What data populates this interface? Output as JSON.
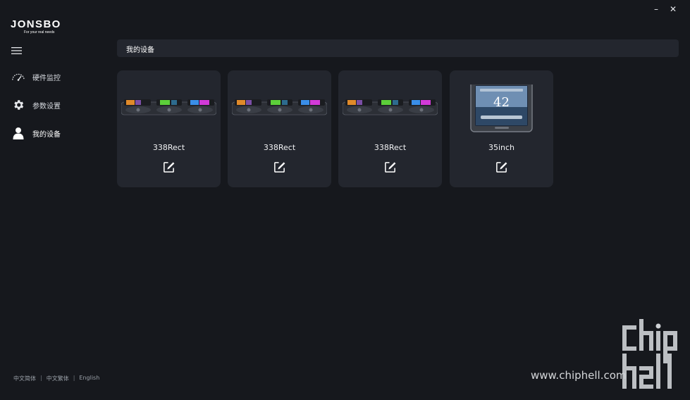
{
  "brand": {
    "name": "JONSBO",
    "tagline": "For your real needs"
  },
  "window": {
    "minimize_label": "–",
    "close_label": "✕"
  },
  "sidebar": {
    "menu_icon": "hamburger-icon",
    "items": [
      {
        "label": "硬件监控",
        "icon": "speedometer-icon",
        "active": false
      },
      {
        "label": "参数设置",
        "icon": "gear-icon",
        "active": false
      },
      {
        "label": "我的设备",
        "icon": "user-icon",
        "active": true
      }
    ]
  },
  "header": {
    "title": "我的设备"
  },
  "devices": [
    {
      "name": "338Rect",
      "image": "gpu-triple-screen",
      "edit_icon": "edit-icon"
    },
    {
      "name": "338Rect",
      "image": "gpu-triple-screen",
      "edit_icon": "edit-icon"
    },
    {
      "name": "338Rect",
      "image": "gpu-triple-screen",
      "edit_icon": "edit-icon"
    },
    {
      "name": "35inch",
      "image": "display-screen",
      "edit_icon": "edit-icon",
      "screen_value": "42"
    }
  ],
  "languages": {
    "items": [
      "中文简体",
      "中文繁体",
      "English"
    ],
    "separator": "|"
  },
  "watermark": {
    "text": "www.chiphell.com",
    "logo_text": "chip hell"
  },
  "colors": {
    "background": "#16181d",
    "card": "#23262e",
    "text": "#e6e8ec"
  }
}
